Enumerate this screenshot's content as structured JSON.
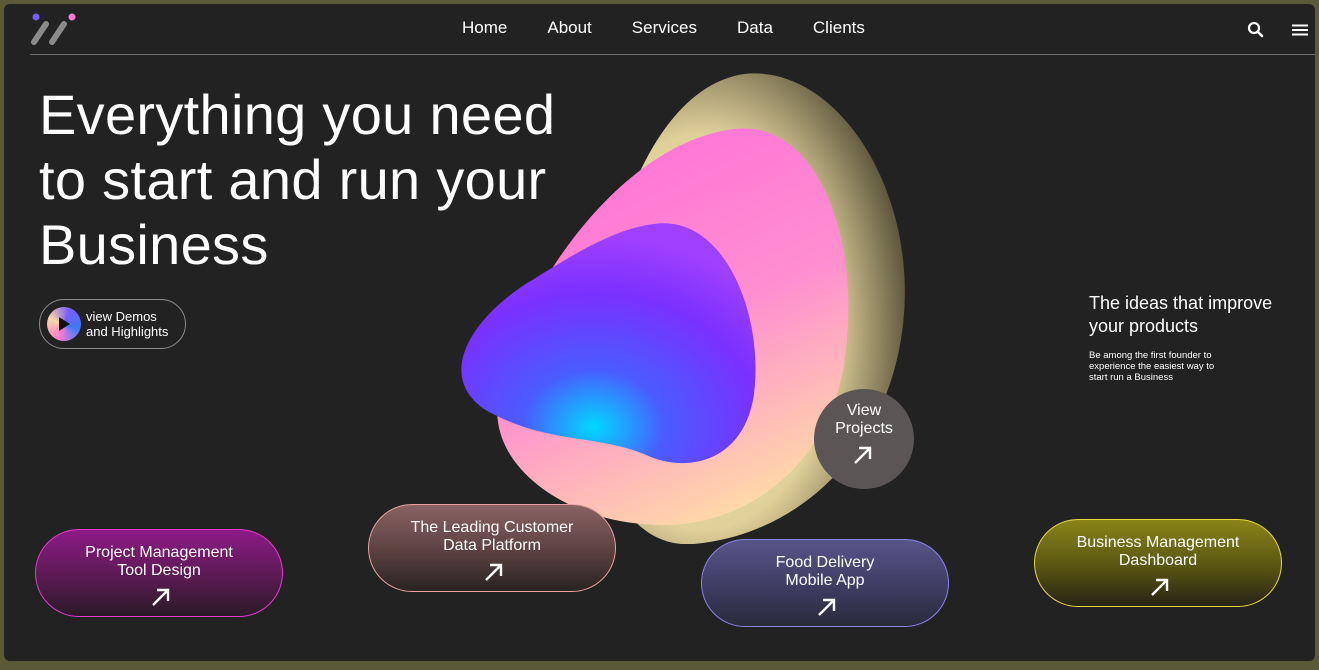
{
  "nav": {
    "items": [
      "Home",
      "About",
      "Services",
      "Data",
      "Clients"
    ],
    "search_icon": "search-icon",
    "menu_icon": "hamburger-menu-icon"
  },
  "hero": {
    "line1": "Everything you need",
    "line2": "to start and run your",
    "line3": "Business"
  },
  "demo": {
    "line1": "view Demos",
    "line2": "and Highlights"
  },
  "view_projects": {
    "line1": "View",
    "line2": "Projects"
  },
  "side": {
    "heading_line1": "The ideas that improve",
    "heading_line2": "your products",
    "text_line1": "Be among the first founder to",
    "text_line2": "experience the easiest way to",
    "text_line3": "start run a Business"
  },
  "projects": [
    {
      "line1": "Project Management",
      "line2": "Tool Design"
    },
    {
      "line1": "The Leading Customer",
      "line2": "Data Platform"
    },
    {
      "line1": "Food Delivery",
      "line2": "Mobile App"
    },
    {
      "line1": "Business Management",
      "line2": "Dashboard"
    }
  ],
  "colors": {
    "background": "#222222",
    "accent_purple": "#7a5cff",
    "accent_pink": "#ff7ad0"
  }
}
